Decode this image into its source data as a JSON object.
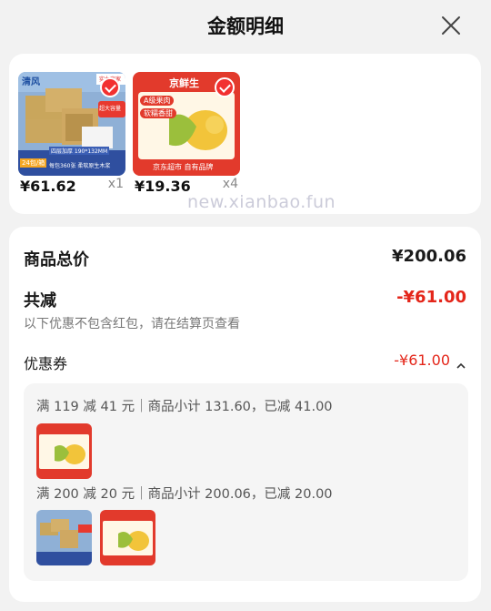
{
  "header": {
    "title": "金额明细",
    "close_icon": "close-icon"
  },
  "products": [
    {
      "brand_text": "清风",
      "store_badge": "实力商家",
      "promo_text": "超大容量",
      "spec_text": "四层加厚 190*132MM",
      "count_badge": "24包/箱",
      "feature_text": "每包360张 柔软原生木浆",
      "price": "¥61.62",
      "qty": "x1"
    },
    {
      "brand_text": "京鲜生",
      "tag1": "A级果肉",
      "tag2": "软糯香甜",
      "footer_text": "京东超市 自有品牌",
      "price": "¥19.36",
      "qty": "x4"
    }
  ],
  "watermark": "new.xianbao.fun",
  "summary": {
    "total_label": "商品总价",
    "total_value": "¥200.06",
    "reduce_label": "共减",
    "reduce_value": "-¥61.00",
    "note": "以下优惠不包含红包，请在结算页查看",
    "coupon_label": "优惠券",
    "coupon_value": "-¥61.00",
    "coupon_toggle_icon": "chevron-up-icon"
  },
  "coupons": [
    {
      "rule": "满 119 减 41 元｜商品小计 131.60，已减 41.00"
    },
    {
      "rule": "满 200 减 20 元｜商品小计 200.06，已减 20.00"
    }
  ],
  "colors": {
    "accent": "#e4261a",
    "background": "#f2f2f2",
    "card": "#ffffff"
  }
}
